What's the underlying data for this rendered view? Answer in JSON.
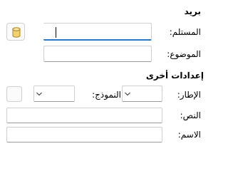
{
  "mail": {
    "heading": "بريد",
    "recipient_label": "المستلم:",
    "recipient_value": "",
    "subject_label": "الموضوع:",
    "subject_value": "",
    "address_book_icon": "database-icon"
  },
  "other": {
    "heading": "إعدادات أخرى",
    "frame_label": "الإطار:",
    "frame_value": "",
    "form_label": "النموذج:",
    "form_value": "",
    "text_label": "النص:",
    "text_value": "",
    "name_label": "الاسم:",
    "name_value": ""
  },
  "colors": {
    "focus_accent": "#2a78c4",
    "icon_fill": "#f2d06b"
  }
}
